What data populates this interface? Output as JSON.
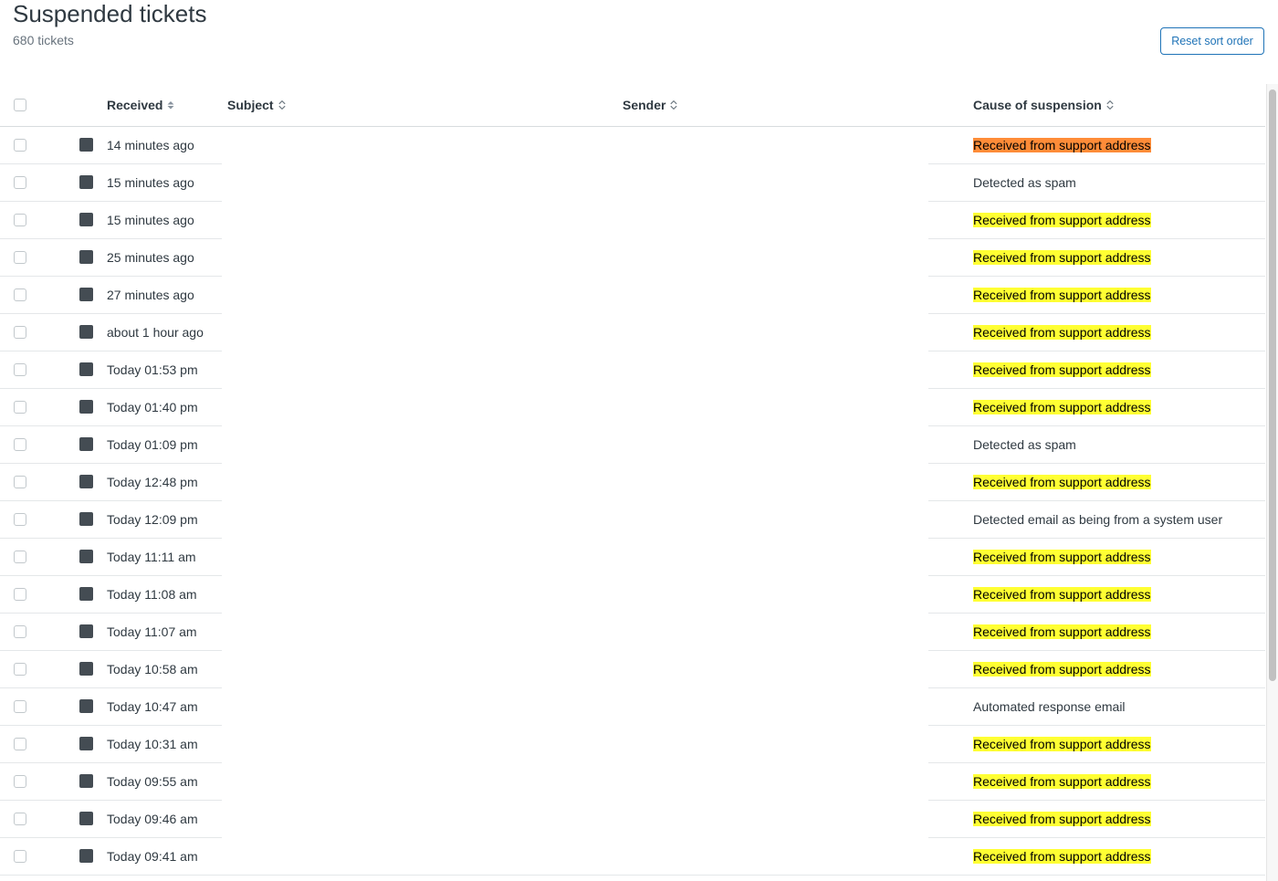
{
  "header": {
    "title": "Suspended tickets",
    "count_label": "680 tickets",
    "reset_button": "Reset sort order"
  },
  "columns": {
    "received": "Received",
    "subject": "Subject",
    "sender": "Sender",
    "cause": "Cause of suspension"
  },
  "colors": {
    "highlight_yellow": "#ffff33",
    "highlight_orange": "#ff8c38",
    "accent_blue": "#1f73b7",
    "status_square": "#444c53"
  },
  "rows": [
    {
      "received": "14 minutes ago",
      "subject": "",
      "sender": "",
      "cause": "Received from support address",
      "highlight": "orange"
    },
    {
      "received": "15 minutes ago",
      "subject": "",
      "sender": "",
      "cause": "Detected as spam",
      "highlight": "none"
    },
    {
      "received": "15 minutes ago",
      "subject": "",
      "sender": "",
      "cause": "Received from support address",
      "highlight": "yellow"
    },
    {
      "received": "25 minutes ago",
      "subject": "",
      "sender": "",
      "cause": "Received from support address",
      "highlight": "yellow"
    },
    {
      "received": "27 minutes ago",
      "subject": "",
      "sender": "",
      "cause": "Received from support address",
      "highlight": "yellow"
    },
    {
      "received": "about 1 hour ago",
      "subject": "",
      "sender": "",
      "cause": "Received from support address",
      "highlight": "yellow"
    },
    {
      "received": "Today 01:53 pm",
      "subject": "",
      "sender": "",
      "cause": "Received from support address",
      "highlight": "yellow"
    },
    {
      "received": "Today 01:40 pm",
      "subject": "",
      "sender": "",
      "cause": "Received from support address",
      "highlight": "yellow"
    },
    {
      "received": "Today 01:09 pm",
      "subject": "",
      "sender": "",
      "cause": "Detected as spam",
      "highlight": "none"
    },
    {
      "received": "Today 12:48 pm",
      "subject": "",
      "sender": "",
      "cause": "Received from support address",
      "highlight": "yellow"
    },
    {
      "received": "Today 12:09 pm",
      "subject": "",
      "sender": "",
      "cause": "Detected email as being from a system user",
      "highlight": "none"
    },
    {
      "received": "Today 11:11 am",
      "subject": "",
      "sender": "",
      "cause": "Received from support address",
      "highlight": "yellow"
    },
    {
      "received": "Today 11:08 am",
      "subject": "",
      "sender": "",
      "cause": "Received from support address",
      "highlight": "yellow"
    },
    {
      "received": "Today 11:07 am",
      "subject": "",
      "sender": "",
      "cause": "Received from support address",
      "highlight": "yellow"
    },
    {
      "received": "Today 10:58 am",
      "subject": "",
      "sender": "",
      "cause": "Received from support address",
      "highlight": "yellow"
    },
    {
      "received": "Today 10:47 am",
      "subject": "",
      "sender": "",
      "cause": "Automated response email",
      "highlight": "none"
    },
    {
      "received": "Today 10:31 am",
      "subject": "",
      "sender": "",
      "cause": "Received from support address",
      "highlight": "yellow"
    },
    {
      "received": "Today 09:55 am",
      "subject": "",
      "sender": "",
      "cause": "Received from support address",
      "highlight": "yellow"
    },
    {
      "received": "Today 09:46 am",
      "subject": "",
      "sender": "",
      "cause": "Received from support address",
      "highlight": "yellow"
    },
    {
      "received": "Today 09:41 am",
      "subject": "",
      "sender": "",
      "cause": "Received from support address",
      "highlight": "yellow"
    }
  ]
}
